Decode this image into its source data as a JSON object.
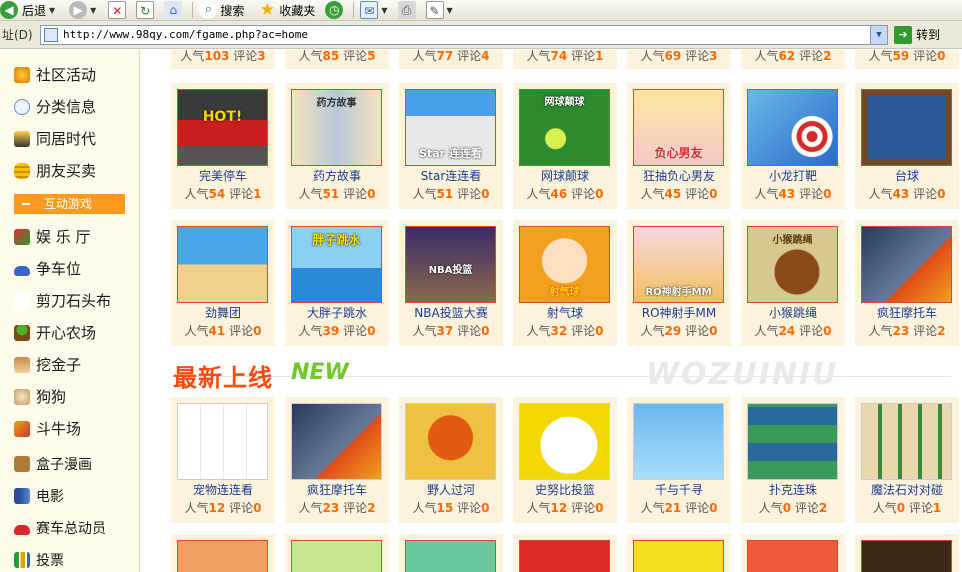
{
  "toolbar": {
    "back_label": "后退",
    "search_label": "搜索",
    "favorites_label": "收藏夹"
  },
  "address": {
    "label": "址(D)",
    "url": "http://www.98qy.com/fgame.php?ac=home",
    "go_label": "转到"
  },
  "sidebar": {
    "items": [
      {
        "label": "社区活动",
        "icon": "globe-icon"
      },
      {
        "label": "分类信息",
        "icon": "chat-icon"
      },
      {
        "label": "同居时代",
        "icon": "house-icon"
      },
      {
        "label": "朋友买卖",
        "icon": "coins-icon"
      },
      {
        "label": "互动游戏",
        "icon": "dash-icon"
      },
      {
        "label": "娱 乐 厅",
        "icon": "joker-icon"
      },
      {
        "label": "争车位",
        "icon": "car-icon"
      },
      {
        "label": "剪刀石头布",
        "icon": "hand-icon"
      },
      {
        "label": "开心农场",
        "icon": "sprout-icon"
      },
      {
        "label": "挖金子",
        "icon": "miner-icon"
      },
      {
        "label": "狗狗",
        "icon": "dog-icon"
      },
      {
        "label": "斗牛场",
        "icon": "bull-icon"
      },
      {
        "label": "盒子漫画",
        "icon": "box-icon"
      },
      {
        "label": "电影",
        "icon": "film-icon"
      },
      {
        "label": "赛车总动员",
        "icon": "racecar-icon"
      },
      {
        "label": "投票",
        "icon": "chart-icon"
      }
    ]
  },
  "stats_labels": {
    "popularity": "人气",
    "comments": "评论"
  },
  "top_partial_row": [
    {
      "pop": "103",
      "com": "3"
    },
    {
      "pop": "85",
      "com": "5"
    },
    {
      "pop": "77",
      "com": "4"
    },
    {
      "pop": "74",
      "com": "1"
    },
    {
      "pop": "69",
      "com": "3"
    },
    {
      "pop": "62",
      "com": "2"
    },
    {
      "pop": "59",
      "com": "0"
    }
  ],
  "row1": [
    {
      "name": "完美停车",
      "pop": "54",
      "com": "1",
      "caption": "HOT!"
    },
    {
      "name": "药方故事",
      "pop": "51",
      "com": "0",
      "caption": "药方故事"
    },
    {
      "name": "Star连连看",
      "pop": "51",
      "com": "0",
      "caption": "Star 连连看"
    },
    {
      "name": "网球颠球",
      "pop": "46",
      "com": "0",
      "caption": "网球颠球"
    },
    {
      "name": "狂抽负心男友",
      "pop": "45",
      "com": "0",
      "caption": "负心男友"
    },
    {
      "name": "小龙打靶",
      "pop": "43",
      "com": "0",
      "caption": ""
    },
    {
      "name": "台球",
      "pop": "43",
      "com": "0",
      "caption": ""
    }
  ],
  "row2": [
    {
      "name": "劲舞团",
      "pop": "41",
      "com": "0",
      "caption": ""
    },
    {
      "name": "大胖子跳水",
      "pop": "39",
      "com": "0",
      "caption": "胖子跳水"
    },
    {
      "name": "NBA投篮大赛",
      "pop": "37",
      "com": "0",
      "caption": "NBA投篮"
    },
    {
      "name": "射气球",
      "pop": "32",
      "com": "0",
      "caption": "射气球"
    },
    {
      "name": "RO神射手MM",
      "pop": "29",
      "com": "0",
      "caption": "RO神射手MM"
    },
    {
      "name": "小猴跳绳",
      "pop": "24",
      "com": "0",
      "caption": "小猴跳绳"
    },
    {
      "name": "疯狂摩托车",
      "pop": "23",
      "com": "2",
      "caption": ""
    }
  ],
  "section": {
    "title": "最新上线",
    "badge": "NEW",
    "watermark": "WOZUINIU"
  },
  "row3": [
    {
      "name": "宠物连连看",
      "pop": "12",
      "com": "0"
    },
    {
      "name": "疯狂摩托车",
      "pop": "23",
      "com": "2"
    },
    {
      "name": "野人过河",
      "pop": "15",
      "com": "0"
    },
    {
      "name": "史努比投篮",
      "pop": "12",
      "com": "0"
    },
    {
      "name": "千与千寻",
      "pop": "21",
      "com": "0"
    },
    {
      "name": "扑克连珠",
      "pop": "0",
      "com": "2"
    },
    {
      "name": "魔法石对对碰",
      "pop": "0",
      "com": "1"
    }
  ],
  "colors": {
    "accent_orange": "#ff6a00",
    "link_blue": "#1b3d8f",
    "card_bg": "#fdf2dc",
    "sidebar_bg": "#fffbea",
    "active_item": "#ff9a1e"
  }
}
